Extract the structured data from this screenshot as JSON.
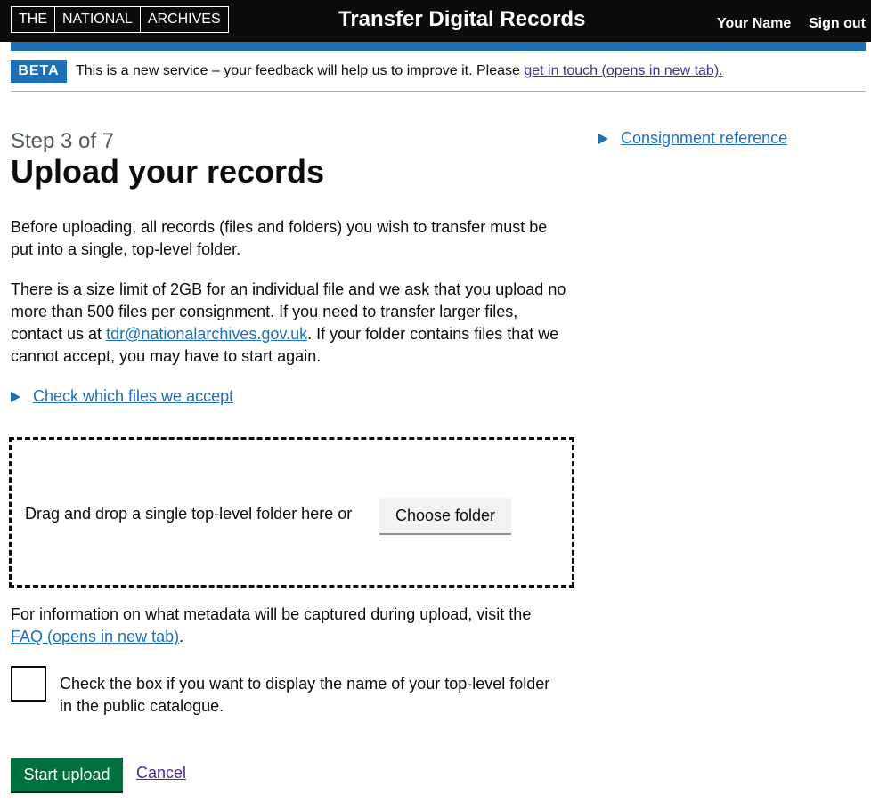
{
  "header": {
    "logo_parts": [
      "THE",
      "NATIONAL",
      "ARCHIVES"
    ],
    "service_name": "Transfer Digital Records",
    "user_name": "Your Name",
    "sign_out": "Sign out"
  },
  "phase_banner": {
    "tag": "BETA",
    "text": "This is a new service – your feedback will help us to improve it. Please ",
    "link": "get in touch (opens in new tab)."
  },
  "main": {
    "step": "Step 3 of 7",
    "title": "Upload your records",
    "para1": "Before uploading, all records (files and folders) you wish to transfer must be put into a single, top-level folder.",
    "para2_before": "There is a size limit of 2GB for an individual file and we ask that you upload no more than 500 files per consignment. If you need to transfer larger files, contact us at ",
    "para2_email": "tdr@nationalarchives.gov.uk",
    "para2_after": ". If your folder contains files that we cannot accept, you may have to start again.",
    "check_files_summary": "Check which files we accept",
    "dropzone_text": "Drag and drop a single top-level folder here or",
    "choose_folder": "Choose folder",
    "metadata_before": "For information on what metadata will be captured during upload, visit the ",
    "metadata_link": "FAQ (opens in new tab)",
    "metadata_after": ".",
    "checkbox_label": "Check the box if you want to display the name of your top-level folder in the public catalogue.",
    "start_upload": "Start upload",
    "cancel": "Cancel"
  },
  "sidebar": {
    "consignment_summary": "Consignment reference"
  },
  "colors": {
    "header_bg": "#0b0c0c",
    "brand_blue": "#1d70b8",
    "button_green": "#00703c",
    "visited_link": "#4c2c92"
  }
}
